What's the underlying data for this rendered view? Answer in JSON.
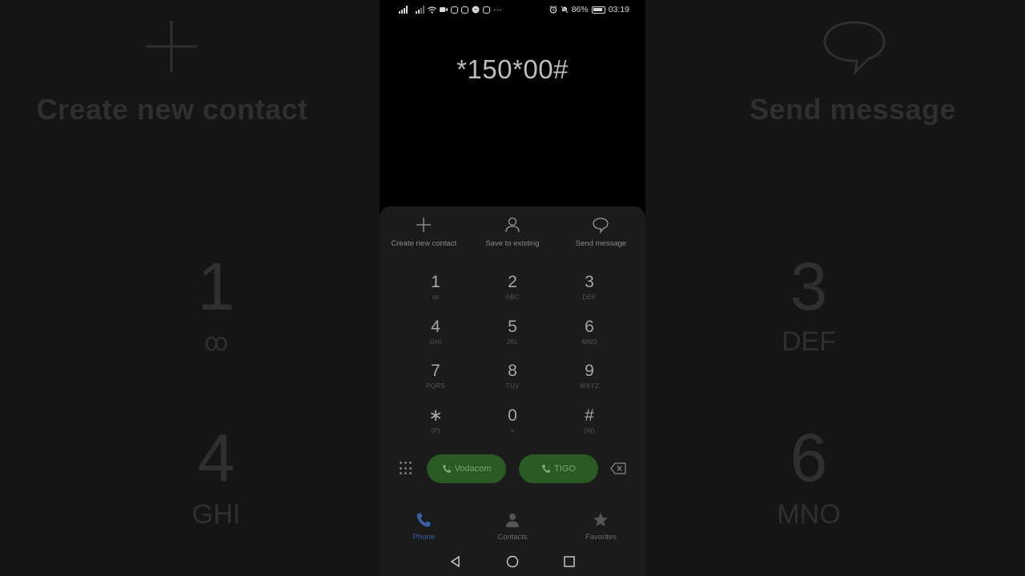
{
  "status_bar": {
    "battery_percent": "86%",
    "time": "03:19",
    "icons_left": [
      "signal-icon",
      "signal-icon",
      "wifi-icon",
      "video-icon",
      "instagram-icon",
      "instagram-icon",
      "messenger-icon",
      "instagram-icon"
    ],
    "overflow": "···",
    "icons_right": [
      "alarm-icon",
      "mute-icon",
      "battery-icon"
    ]
  },
  "dialer": {
    "number": "*150*00#"
  },
  "actions": [
    {
      "label": "Create new contact",
      "icon": "plus-icon"
    },
    {
      "label": "Save to existing",
      "icon": "person-icon"
    },
    {
      "label": "Send message",
      "icon": "message-icon"
    }
  ],
  "keys": [
    {
      "digit": "1",
      "letters": "ꝏ"
    },
    {
      "digit": "2",
      "letters": "ABC"
    },
    {
      "digit": "3",
      "letters": "DEF"
    },
    {
      "digit": "4",
      "letters": "GHI"
    },
    {
      "digit": "5",
      "letters": "JKL"
    },
    {
      "digit": "6",
      "letters": "MNO"
    },
    {
      "digit": "7",
      "letters": "PQRS"
    },
    {
      "digit": "8",
      "letters": "TUV"
    },
    {
      "digit": "9",
      "letters": "WXYZ"
    },
    {
      "digit": "∗",
      "letters": "(P)"
    },
    {
      "digit": "0",
      "letters": "+"
    },
    {
      "digit": "#",
      "letters": "(W)"
    }
  ],
  "call_buttons": [
    {
      "label": "Vodacom"
    },
    {
      "label": "TIGO"
    }
  ],
  "tabs": [
    {
      "label": "Phone",
      "active": true
    },
    {
      "label": "Contacts",
      "active": false
    },
    {
      "label": "Favorites",
      "active": false
    }
  ],
  "backdrop": {
    "left_title": "Create new contact",
    "right_title": "Send message",
    "digits": [
      {
        "digit": "1",
        "letters": "ꝏ"
      },
      {
        "digit": "3",
        "letters": "DEF"
      },
      {
        "digit": "4",
        "letters": "GHI"
      },
      {
        "digit": "6",
        "letters": "MNO"
      }
    ]
  },
  "colors": {
    "accent_blue": "#3a5fa6",
    "call_green": "#2a5a23",
    "pad_background": "#1b1b1b"
  }
}
